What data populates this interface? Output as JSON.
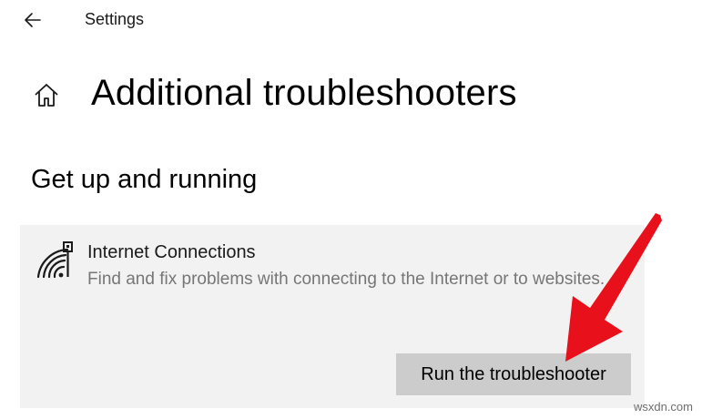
{
  "window": {
    "title": "Settings"
  },
  "page": {
    "title": "Additional troubleshooters",
    "section_title": "Get up and running"
  },
  "troubleshooter": {
    "icon": "wifi-network-icon",
    "title": "Internet Connections",
    "description": "Find and fix problems with connecting to the Internet or to websites.",
    "button_label": "Run the troubleshooter"
  },
  "annotation": {
    "color": "#e8101a"
  },
  "watermark": "wsxdn.com"
}
